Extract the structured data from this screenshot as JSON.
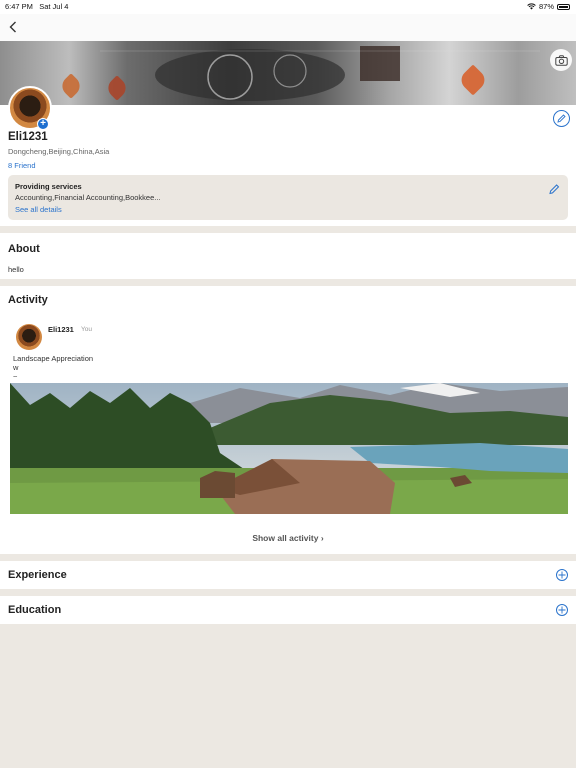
{
  "status_bar": {
    "time": "6:47 PM",
    "date": "Sat Jul 4",
    "battery": "87%"
  },
  "profile": {
    "username": "Eli1231",
    "location": "Dongcheng,Beijing,China,Asia",
    "friends": "8 Friend"
  },
  "services": {
    "title": "Providing services",
    "list": "Accounting,Financial Accounting,Bookkee...",
    "link": "See all details"
  },
  "about": {
    "title": "About",
    "text": "hello"
  },
  "activity": {
    "title": "Activity",
    "post": {
      "user": "Eli1231",
      "tag": "You",
      "line1": "Landscape Appreciation",
      "line2": "w",
      "line3": "~"
    },
    "show_all": "Show all activity"
  },
  "experience": {
    "title": "Experience"
  },
  "education": {
    "title": "Education"
  },
  "icons": {
    "back": "chevron-left-icon",
    "camera": "camera-icon",
    "edit": "pencil-icon",
    "add": "plus-circle-icon",
    "wifi": "wifi-icon",
    "battery": "battery-icon"
  },
  "colors": {
    "accent": "#2a73cc",
    "background": "#ece8e2",
    "card": "#ffffff"
  }
}
